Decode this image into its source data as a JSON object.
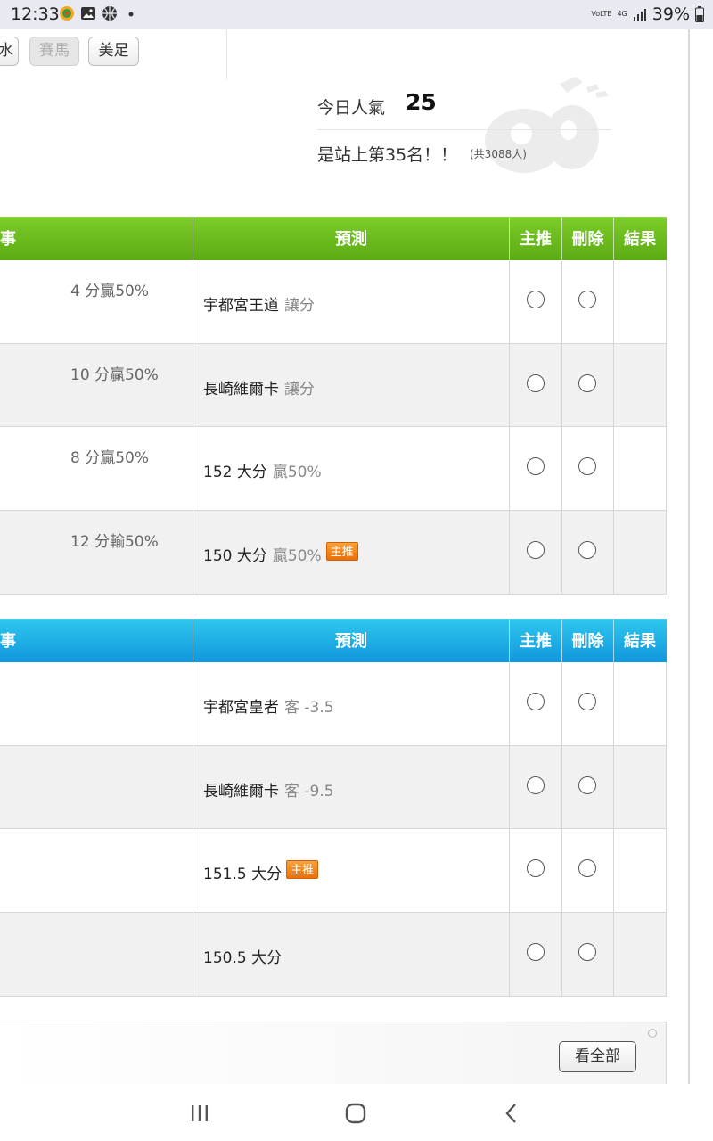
{
  "status_bar": {
    "time": "12:33",
    "icons": [
      "game-icon",
      "image-icon",
      "basketball-icon",
      "dot-icon"
    ],
    "volte": "VoLTE",
    "network": "4G",
    "battery": "39%"
  },
  "tabs": [
    {
      "label": "水",
      "enabled": true
    },
    {
      "label": "賽馬",
      "enabled": false
    },
    {
      "label": "美足",
      "enabled": true
    }
  ],
  "popularity": {
    "label": "今日人氣",
    "value": "25",
    "rank_text": "是站上第35名！！",
    "total_text": "(共3088人)"
  },
  "table1": {
    "color": "#6cbd1e",
    "headers": {
      "event": "事",
      "prediction": "預測",
      "main_pick": "主推",
      "delete": "刪除",
      "result": "結果"
    },
    "rows": [
      {
        "result_left": "4 分贏50%",
        "prediction": "宇都宮王道",
        "sub": "讓分",
        "badge": ""
      },
      {
        "result_left": "10 分贏50%",
        "prediction": "長崎維爾卡",
        "sub": "讓分",
        "badge": ""
      },
      {
        "result_left": "8 分贏50%",
        "prediction": "152 大分",
        "sub": "贏50%",
        "badge": ""
      },
      {
        "result_left": "12 分輸50%",
        "prediction": "150 大分",
        "sub": "贏50%",
        "badge": "主推"
      }
    ]
  },
  "table2": {
    "color": "#1aa6e4",
    "headers": {
      "event": "事",
      "prediction": "預測",
      "main_pick": "主推",
      "delete": "刪除",
      "result": "結果"
    },
    "rows": [
      {
        "prediction": "宇都宮皇者",
        "sub": "客 -3.5",
        "badge": ""
      },
      {
        "prediction": "長崎維爾卡",
        "sub": "客 -9.5",
        "badge": ""
      },
      {
        "prediction": "151.5 大分",
        "sub": "",
        "badge": "主推"
      },
      {
        "prediction": "150.5 大分",
        "sub": "",
        "badge": ""
      }
    ]
  },
  "footer": {
    "see_all_label": "看全部"
  },
  "nav": [
    "recent-apps-icon",
    "home-icon",
    "back-icon"
  ]
}
